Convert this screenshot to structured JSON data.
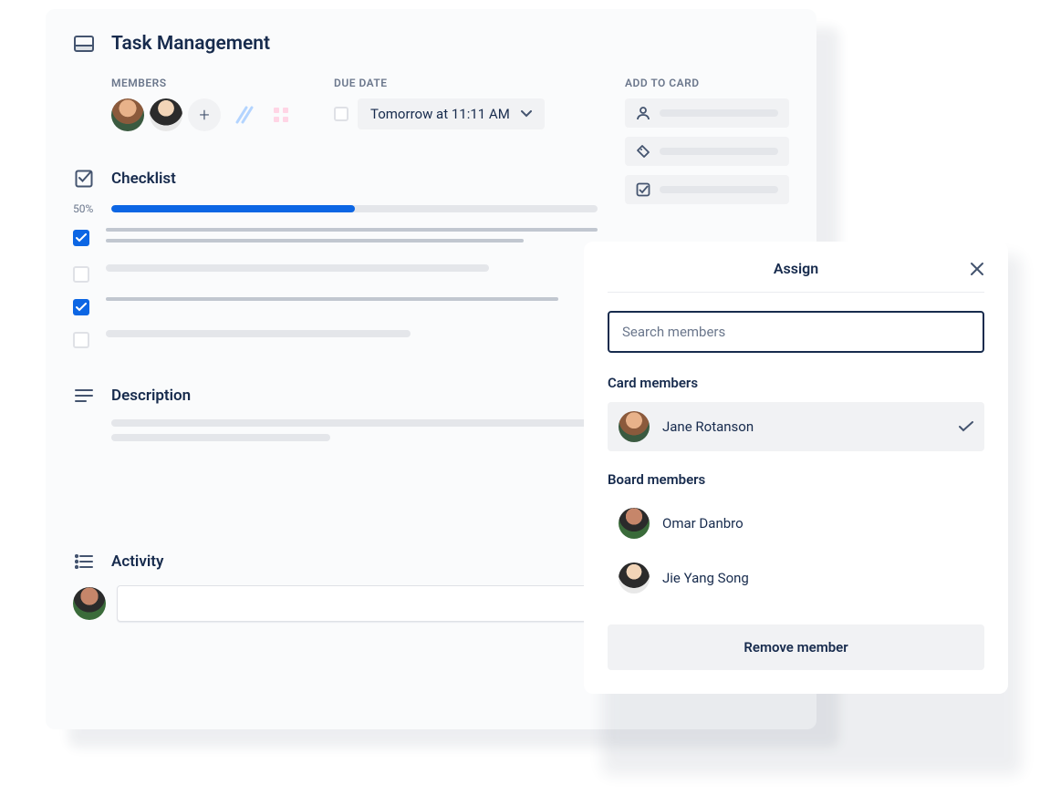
{
  "card": {
    "title": "Task Management",
    "labels": {
      "members": "MEMBERS",
      "due_date": "DUE DATE",
      "add_to_card": "ADD TO CARD"
    },
    "members": [
      {
        "name": "Jane Rotanson"
      },
      {
        "name": "Jie Yang Song"
      }
    ],
    "due_date_value": "Tomorrow at 11:11 AM",
    "checklist": {
      "title": "Checklist",
      "progress_label": "50%",
      "progress_pct": 50,
      "items": [
        {
          "checked": true
        },
        {
          "checked": false
        },
        {
          "checked": true
        },
        {
          "checked": false
        }
      ]
    },
    "description": {
      "title": "Description"
    },
    "activity": {
      "title": "Activity"
    }
  },
  "popover": {
    "title": "Assign",
    "search_placeholder": "Search members",
    "card_members_label": "Card members",
    "board_members_label": "Board members",
    "remove_button": "Remove member",
    "card_members": [
      {
        "name": "Jane Rotanson",
        "selected": true
      }
    ],
    "board_members": [
      {
        "name": "Omar Danbro"
      },
      {
        "name": "Jie Yang Song"
      }
    ]
  },
  "colors": {
    "accent": "#0c66e4",
    "text_primary": "#172b4d",
    "text_subtle": "#6b778c"
  }
}
